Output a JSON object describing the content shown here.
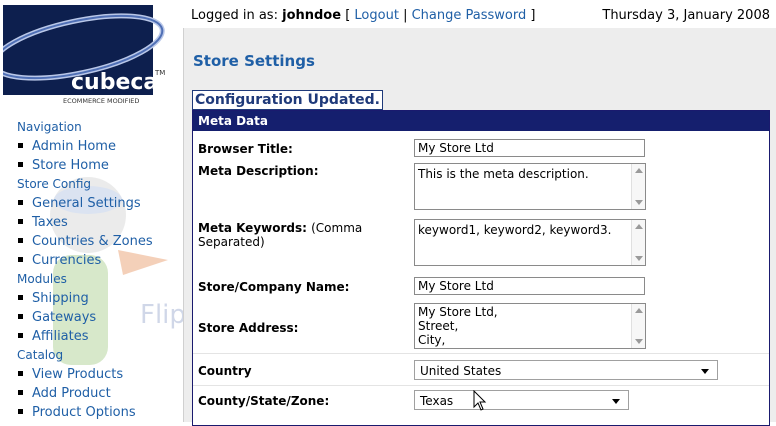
{
  "brand": {
    "logo_text": "cubecart",
    "logo_tm": "TM",
    "logo_tagline": "ECOMMERCE MODIFIED",
    "watermark_text": "FlipperHost"
  },
  "header": {
    "logged_in_prefix": "Logged in as:",
    "username": "johndoe",
    "bracket_open": "[",
    "logout_label": "Logout",
    "separator": "|",
    "change_password_label": "Change Password",
    "bracket_close": "]",
    "date": "Thursday 3, January 2008"
  },
  "sidebar": {
    "sections": [
      {
        "heading": "Navigation",
        "items": [
          "Admin Home",
          "Store Home"
        ]
      },
      {
        "heading": "Store Config",
        "items": [
          "General Settings",
          "Taxes",
          "Countries & Zones",
          "Currencies"
        ]
      },
      {
        "heading": "Modules",
        "items": [
          "Shipping",
          "Gateways",
          "Affiliates"
        ]
      },
      {
        "heading": "Catalog",
        "items": [
          "View Products",
          "Add Product",
          "Product Options"
        ]
      }
    ]
  },
  "main": {
    "page_title": "Store Settings",
    "notice": "Configuration Updated.",
    "panel_title": "Meta Data",
    "fields": {
      "browser_title": {
        "label": "Browser Title:",
        "value": "My Store Ltd"
      },
      "meta_description": {
        "label": "Meta Description:",
        "value": "This is the meta description."
      },
      "meta_keywords": {
        "label": "Meta Keywords:",
        "note": "(Comma Separated)",
        "value": "keyword1, keyword2, keyword3."
      },
      "store_name": {
        "label": "Store/Company Name:",
        "value": "My Store Ltd"
      },
      "store_address": {
        "label": "Store Address:",
        "value": "My Store Ltd,\nStreet,\nCity,"
      },
      "country": {
        "label": "Country",
        "value": "United States"
      },
      "county": {
        "label": "County/State/Zone:",
        "value": "Texas"
      }
    }
  },
  "colors": {
    "link_blue": "#1f5fa6",
    "panel_header": "#151f6e",
    "main_bg": "#ededed"
  }
}
